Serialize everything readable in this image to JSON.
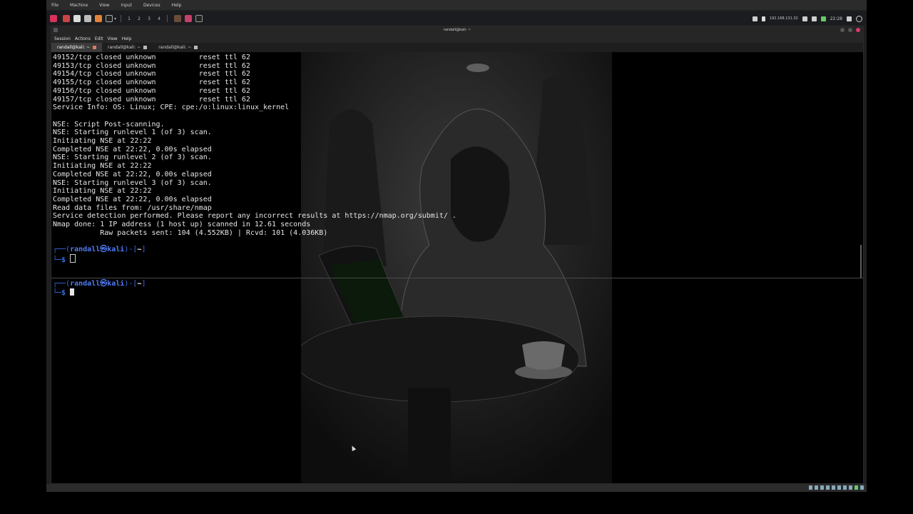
{
  "host_menu": [
    "File",
    "Machine",
    "View",
    "Input",
    "Devices",
    "Help"
  ],
  "panel": {
    "workspaces": [
      "1",
      "2",
      "3",
      "4"
    ],
    "ip": "192.168.131.32",
    "clock": "22:28"
  },
  "terminal": {
    "title": "randall@kali: ~",
    "menu": [
      "Session",
      "Actions",
      "Edit",
      "View",
      "Help"
    ],
    "tabs": [
      {
        "label": "randall@kali: ~",
        "active": true
      },
      {
        "label": "randall@kali: ~",
        "active": false
      },
      {
        "label": "randall@kali: ~",
        "active": false
      }
    ],
    "output_lines": [
      "49152/tcp closed unknown          reset ttl 62",
      "49153/tcp closed unknown          reset ttl 62",
      "49154/tcp closed unknown          reset ttl 62",
      "49155/tcp closed unknown          reset ttl 62",
      "49156/tcp closed unknown          reset ttl 62",
      "49157/tcp closed unknown          reset ttl 62",
      "Service Info: OS: Linux; CPE: cpe:/o:linux:linux_kernel",
      "",
      "NSE: Script Post-scanning.",
      "NSE: Starting runlevel 1 (of 3) scan.",
      "Initiating NSE at 22:22",
      "Completed NSE at 22:22, 0.00s elapsed",
      "NSE: Starting runlevel 2 (of 3) scan.",
      "Initiating NSE at 22:22",
      "Completed NSE at 22:22, 0.00s elapsed",
      "NSE: Starting runlevel 3 (of 3) scan.",
      "Initiating NSE at 22:22",
      "Completed NSE at 22:22, 0.00s elapsed",
      "Read data files from: /usr/share/nmap",
      "Service detection performed. Please report any incorrect results at https://nmap.org/submit/ .",
      "Nmap done: 1 IP address (1 host up) scanned in 12.61 seconds",
      "           Raw packets sent: 104 (4.552KB) | Rcvd: 101 (4.036KB)"
    ],
    "prompt": {
      "corner_top": "┌──(",
      "user": "randall",
      "at": "㉿",
      "host": "kali",
      "mid": ")-[",
      "cwd": "~",
      "close": "]",
      "corner_bottom": "└─",
      "symbol": "$"
    }
  }
}
